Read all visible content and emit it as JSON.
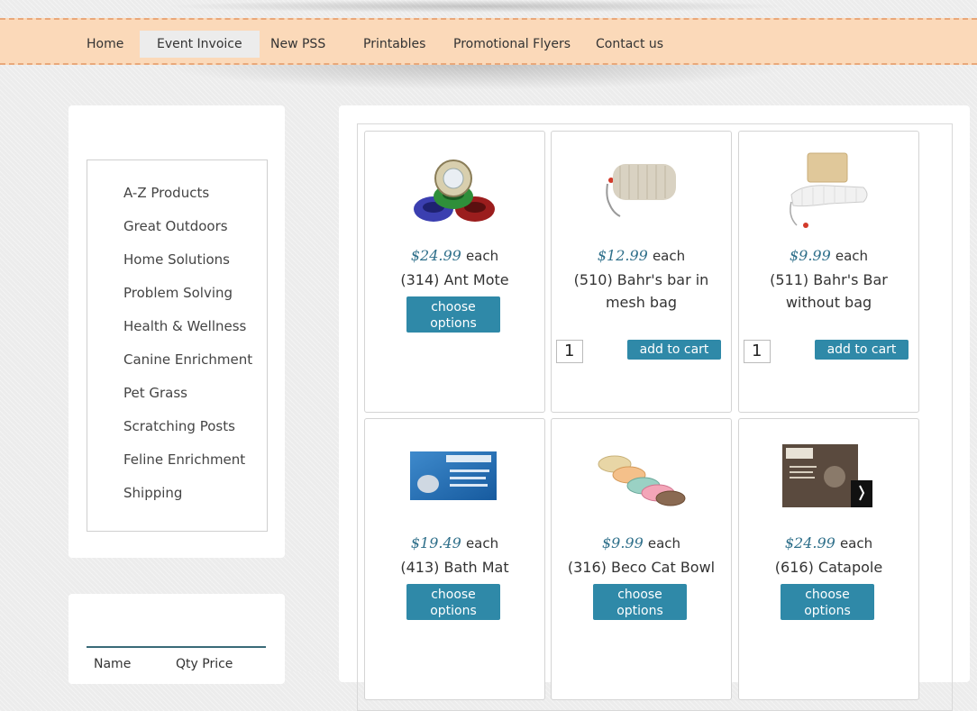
{
  "nav": {
    "items": [
      {
        "label": "Home"
      },
      {
        "label": "Event Invoice"
      },
      {
        "label": "New PSS"
      },
      {
        "label": "Printables"
      },
      {
        "label": "Promotional Flyers"
      },
      {
        "label": "Contact us"
      }
    ],
    "active": "Event Invoice"
  },
  "sidebar": {
    "categories": [
      {
        "label": "A-Z Products"
      },
      {
        "label": "Great Outdoors"
      },
      {
        "label": "Home Solutions"
      },
      {
        "label": "Problem Solving"
      },
      {
        "label": "Health & Wellness"
      },
      {
        "label": "Canine Enrichment"
      },
      {
        "label": "Pet Grass"
      },
      {
        "label": "Scratching Posts"
      },
      {
        "label": "Feline Enrichment"
      },
      {
        "label": "Shipping"
      }
    ]
  },
  "cart": {
    "col_name": "Name",
    "col_qty_price": "Qty Price"
  },
  "products": [
    {
      "price": "$24.99",
      "each": "each",
      "name": "(314) Ant Mote",
      "action": "choose options",
      "icon": "ant-mote-image"
    },
    {
      "price": "$12.99",
      "each": "each",
      "name": "(510) Bahr's bar in mesh bag",
      "action": "add to cart",
      "qty": "1",
      "icon": "mesh-bag-soap-image"
    },
    {
      "price": "$9.99",
      "each": "each",
      "name": "(511) Bahr's Bar without bag",
      "action": "add to cart",
      "qty": "1",
      "icon": "soap-bar-image"
    },
    {
      "price": "$19.49",
      "each": "each",
      "name": "(413) Bath Mat",
      "action": "choose options",
      "icon": "bath-mat-image"
    },
    {
      "price": "$9.99",
      "each": "each",
      "name": "(316) Beco Cat Bowl",
      "action": "choose options",
      "icon": "cat-bowls-image"
    },
    {
      "price": "$24.99",
      "each": "each",
      "name": "(616) Catapole",
      "action": "choose options",
      "icon": "catapole-box-image"
    }
  ],
  "colors": {
    "nav_bg": "#fbd9b9",
    "nav_border": "#e9a87a",
    "button": "#2f89a8",
    "price": "#2e6f8a"
  }
}
